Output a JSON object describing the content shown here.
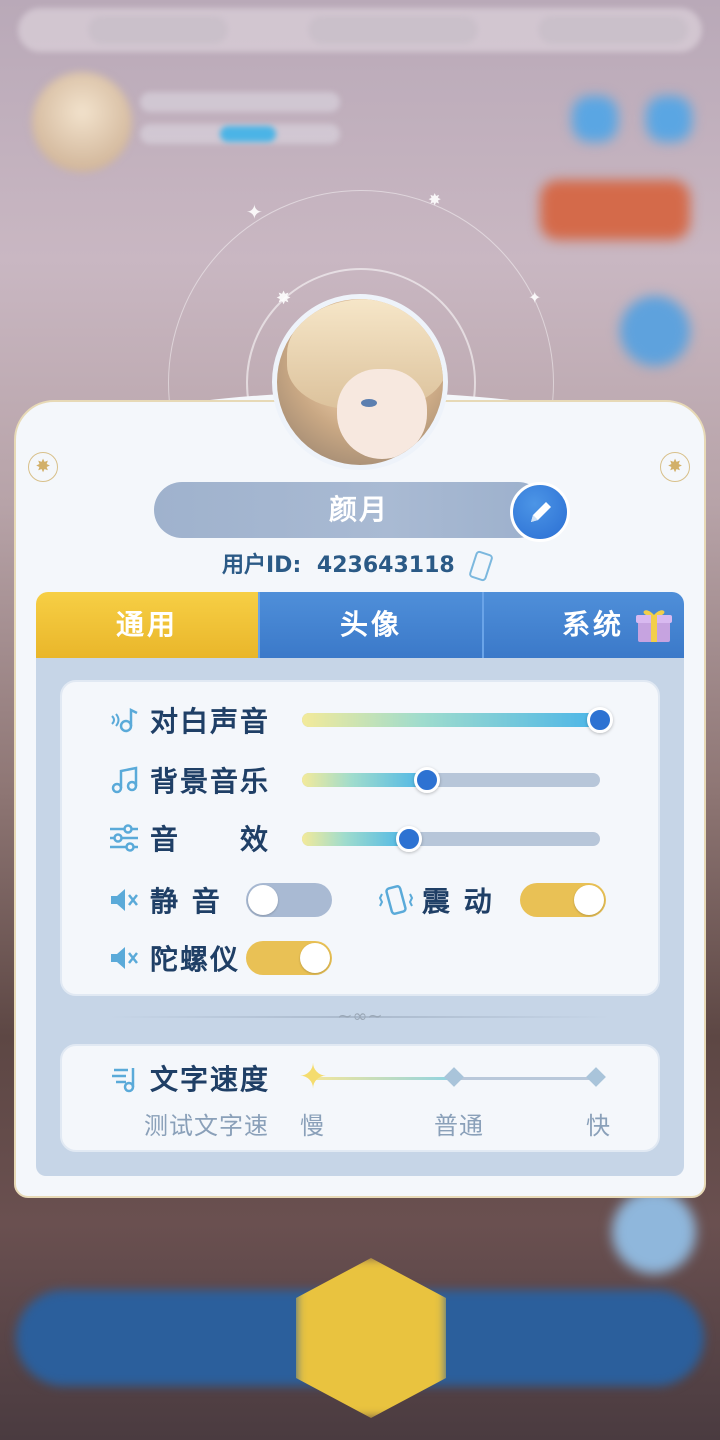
{
  "profile": {
    "name": "颜月",
    "uid_label": "用户ID:",
    "uid_value": "423643118"
  },
  "tabs": [
    {
      "label": "通用",
      "active": true
    },
    {
      "label": "头像",
      "active": false
    },
    {
      "label": "系统",
      "active": false
    }
  ],
  "settings": {
    "dialogue_voice": {
      "label": "对白声音",
      "value": 1.0
    },
    "bgm": {
      "label": "背景音乐",
      "value": 0.42
    },
    "sfx": {
      "label": "音　　效",
      "value": 0.36
    },
    "mute": {
      "label": "静 音",
      "on": false
    },
    "vibration": {
      "label": "震 动",
      "on": true
    },
    "gyroscope": {
      "label": "陀螺仪",
      "on": true
    }
  },
  "text_speed": {
    "label": "文字速度",
    "preview": "测试文字速",
    "slow": "慢",
    "normal": "普通",
    "fast": "快",
    "value": "慢"
  },
  "colors": {
    "accent_blue": "#2d72d2",
    "tab_active": "#f7cf45",
    "toggle_on": "#e9c155",
    "toggle_off": "#a9bad3"
  }
}
